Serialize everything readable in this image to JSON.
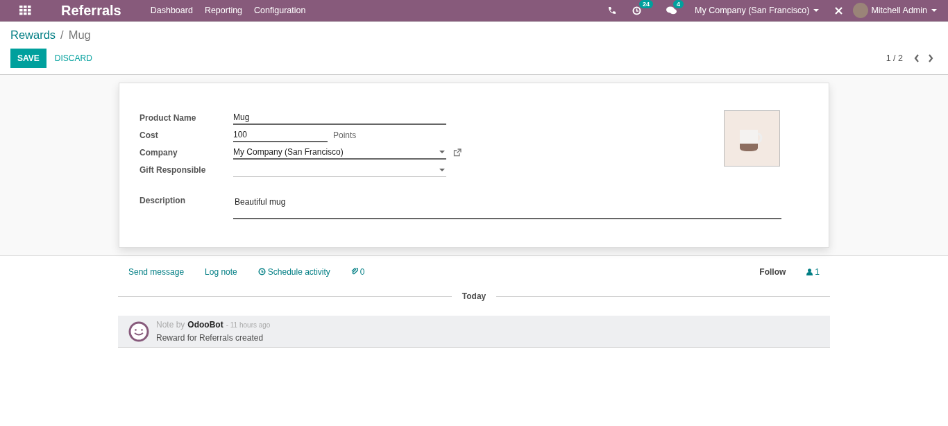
{
  "navbar": {
    "app_title": "Referrals",
    "menu": [
      "Dashboard",
      "Reporting",
      "Configuration"
    ],
    "activity_count": "24",
    "message_count": "4",
    "company": "My Company (San Francisco)",
    "user": "Mitchell Admin"
  },
  "breadcrumb": {
    "parent": "Rewards",
    "separator": "/",
    "current": "Mug"
  },
  "buttons": {
    "save": "SAVE",
    "discard": "DISCARD"
  },
  "pager": {
    "value": "1 / 2"
  },
  "form": {
    "fields": [
      {
        "label": "Product Name",
        "kind": "text",
        "value": "Mug"
      },
      {
        "label": "Cost",
        "kind": "unit",
        "value": "100",
        "unit": "Points"
      },
      {
        "label": "Company",
        "kind": "select_link",
        "value": "My Company (San Francisco)"
      },
      {
        "label": "Gift Responsible",
        "kind": "select"
      }
    ],
    "description": {
      "label": "Description",
      "value": "Beautiful mug"
    }
  },
  "chatter": {
    "send_message": "Send message",
    "log_note": "Log note",
    "schedule_activity": "Schedule activity",
    "attachments": "0",
    "follow": "Follow",
    "followers": "1",
    "date_separator": "Today",
    "messages": [
      {
        "type": "Note by",
        "author": "OdooBot",
        "time": "- 11 hours ago",
        "body": "Reward for Referrals created"
      }
    ]
  }
}
